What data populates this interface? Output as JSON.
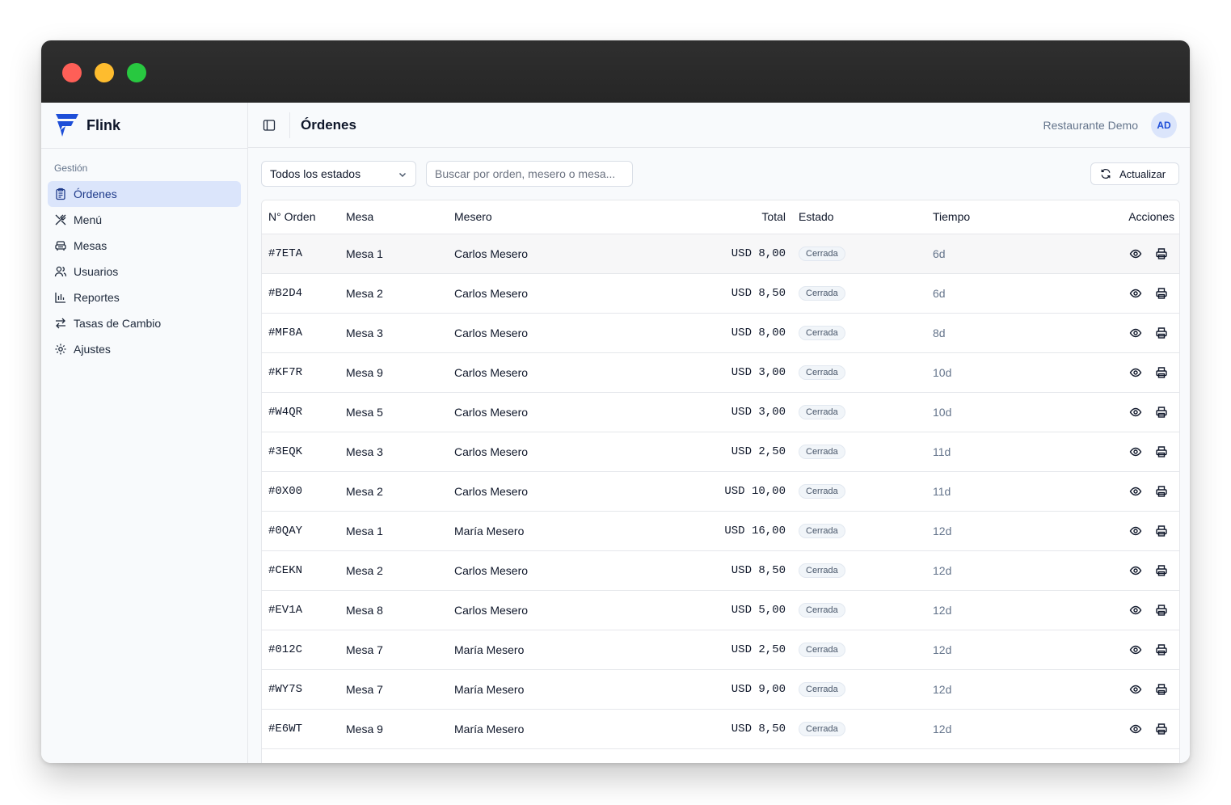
{
  "brand": {
    "name": "Flink",
    "accent": "#1d4ed8"
  },
  "sidebar": {
    "group_label": "Gestión",
    "items": [
      {
        "label": "Órdenes",
        "icon": "clipboard-icon",
        "active": true
      },
      {
        "label": "Menú",
        "icon": "utensils-icon"
      },
      {
        "label": "Mesas",
        "icon": "armchair-icon"
      },
      {
        "label": "Usuarios",
        "icon": "users-icon"
      },
      {
        "label": "Reportes",
        "icon": "bar-chart-icon"
      },
      {
        "label": "Tasas de Cambio",
        "icon": "arrows-exchange-icon"
      },
      {
        "label": "Ajustes",
        "icon": "gear-icon"
      }
    ]
  },
  "header": {
    "title": "Órdenes",
    "restaurant": "Restaurante Demo",
    "avatar_initials": "AD"
  },
  "toolbar": {
    "status_filter": "Todos los estados",
    "search_placeholder": "Buscar por orden, mesero o mesa...",
    "refresh_label": "Actualizar"
  },
  "table": {
    "columns": [
      "N° Orden",
      "Mesa",
      "Mesero",
      "Total",
      "Estado",
      "Tiempo",
      "Acciones"
    ],
    "rows": [
      {
        "id": "#7ETA",
        "mesa": "Mesa 1",
        "mesero": "Carlos Mesero",
        "total": "USD 8,00",
        "estado": "Cerrada",
        "tiempo": "6d"
      },
      {
        "id": "#B2D4",
        "mesa": "Mesa 2",
        "mesero": "Carlos Mesero",
        "total": "USD 8,50",
        "estado": "Cerrada",
        "tiempo": "6d"
      },
      {
        "id": "#MF8A",
        "mesa": "Mesa 3",
        "mesero": "Carlos Mesero",
        "total": "USD 8,00",
        "estado": "Cerrada",
        "tiempo": "8d"
      },
      {
        "id": "#KF7R",
        "mesa": "Mesa 9",
        "mesero": "Carlos Mesero",
        "total": "USD 3,00",
        "estado": "Cerrada",
        "tiempo": "10d"
      },
      {
        "id": "#W4QR",
        "mesa": "Mesa 5",
        "mesero": "Carlos Mesero",
        "total": "USD 3,00",
        "estado": "Cerrada",
        "tiempo": "10d"
      },
      {
        "id": "#3EQK",
        "mesa": "Mesa 3",
        "mesero": "Carlos Mesero",
        "total": "USD 2,50",
        "estado": "Cerrada",
        "tiempo": "11d"
      },
      {
        "id": "#0X00",
        "mesa": "Mesa 2",
        "mesero": "Carlos Mesero",
        "total": "USD 10,00",
        "estado": "Cerrada",
        "tiempo": "11d"
      },
      {
        "id": "#0QAY",
        "mesa": "Mesa 1",
        "mesero": "María Mesero",
        "total": "USD 16,00",
        "estado": "Cerrada",
        "tiempo": "12d"
      },
      {
        "id": "#CEKN",
        "mesa": "Mesa 2",
        "mesero": "Carlos Mesero",
        "total": "USD 8,50",
        "estado": "Cerrada",
        "tiempo": "12d"
      },
      {
        "id": "#EV1A",
        "mesa": "Mesa 8",
        "mesero": "Carlos Mesero",
        "total": "USD 5,00",
        "estado": "Cerrada",
        "tiempo": "12d"
      },
      {
        "id": "#012C",
        "mesa": "Mesa 7",
        "mesero": "María Mesero",
        "total": "USD 2,50",
        "estado": "Cerrada",
        "tiempo": "12d"
      },
      {
        "id": "#WY7S",
        "mesa": "Mesa 7",
        "mesero": "María Mesero",
        "total": "USD 9,00",
        "estado": "Cerrada",
        "tiempo": "12d"
      },
      {
        "id": "#E6WT",
        "mesa": "Mesa 9",
        "mesero": "María Mesero",
        "total": "USD 8,50",
        "estado": "Cerrada",
        "tiempo": "12d"
      }
    ]
  }
}
